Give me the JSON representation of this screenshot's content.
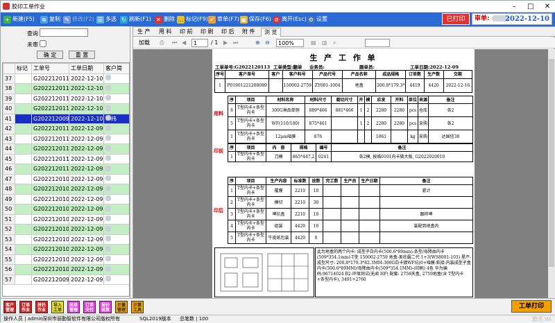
{
  "window": {
    "title": "胶印工单作业"
  },
  "toolbar": {
    "new": "新建(F5)",
    "copy": "复制",
    "modify": "修改(F2)",
    "multiselect": "多选",
    "refresh": "刷新(F1)",
    "delete": "删除",
    "mark": "标记(F9)",
    "review": "审单(F7)",
    "save": "保存(F6)",
    "exit": "离开(Esc)",
    "settings": "设置"
  },
  "status_badges": {
    "printed": "已打印",
    "review_label": "审单:",
    "review_date": "2022-12-10"
  },
  "filter": {
    "query_label": "查询",
    "unreviewed_label": "未审",
    "confirm": "确 定",
    "reset": "重 置"
  },
  "list": {
    "columns": [
      "",
      "标记",
      "工单号",
      "工单日期",
      "客户简"
    ],
    "rows": [
      {
        "n": "37",
        "id": "G2022120118",
        "date": "2022-12-10",
        "style": "w",
        "tail": ""
      },
      {
        "n": "38",
        "id": "G2022120117",
        "date": "2022-12-10",
        "style": "g",
        "tail": ""
      },
      {
        "n": "39",
        "id": "G2022120116",
        "date": "2022-12-10",
        "style": "w",
        "tail": ""
      },
      {
        "n": "40",
        "id": "G2022120115",
        "date": "2022-12-10",
        "style": "g",
        "tail": ""
      },
      {
        "n": "41",
        "id": "G2022120099",
        "date": "2022-12-10",
        "style": "sel",
        "tail": "纬"
      },
      {
        "n": "42",
        "id": "G2022120114",
        "date": "2022-12-09",
        "style": "g",
        "tail": ""
      },
      {
        "n": "43",
        "id": "G2022120113",
        "date": "2022-12-09",
        "style": "w",
        "tail": ""
      },
      {
        "n": "44",
        "id": "G2022120112",
        "date": "2022-12-09",
        "style": "g",
        "tail": ""
      },
      {
        "n": "45",
        "id": "G2022120111",
        "date": "2022-12-09",
        "style": "w",
        "tail": ""
      },
      {
        "n": "46",
        "id": "G2022120110",
        "date": "2022-12-09",
        "style": "g",
        "tail": ""
      },
      {
        "n": "47",
        "id": "G2022120109",
        "date": "2022-12-09",
        "style": "w",
        "tail": ""
      },
      {
        "n": "48",
        "id": "G2022120108",
        "date": "2022-12-09",
        "style": "g",
        "tail": ""
      },
      {
        "n": "49",
        "id": "G2022120107",
        "date": "2022-12-09",
        "style": "w",
        "tail": ""
      },
      {
        "n": "50",
        "id": "G2022120106",
        "date": "2022-12-09",
        "style": "g",
        "tail": ""
      },
      {
        "n": "51",
        "id": "G2022120105",
        "date": "2022-12-09",
        "style": "w",
        "tail": ""
      },
      {
        "n": "52",
        "id": "G2022120104",
        "date": "2022-12-09",
        "style": "g",
        "tail": ""
      },
      {
        "n": "53",
        "id": "G2022120103",
        "date": "2022-12-09",
        "style": "w",
        "tail": ""
      },
      {
        "n": "54",
        "id": "G2022120102",
        "date": "2022-12-09",
        "style": "g",
        "tail": ""
      },
      {
        "n": "55",
        "id": "G2022120101",
        "date": "2022-12-09",
        "style": "w",
        "tail": ""
      },
      {
        "n": "56",
        "id": "G2022120100",
        "date": "2022-12-09",
        "style": "g",
        "tail": ""
      },
      {
        "n": "57",
        "id": "G2022120098",
        "date": "2022-12-09",
        "style": "w",
        "tail": ""
      }
    ]
  },
  "tabs": [
    "生 产",
    "用 料",
    "印 前",
    "印 刷",
    "印 后",
    "附 件",
    "浏 览"
  ],
  "viewer_toolbar": {
    "load": "加载",
    "page": "1",
    "of": "/ 1",
    "zoom": "100%"
  },
  "doc": {
    "title": "生 产 工 作 单",
    "order_no": "工单单号:G2022120113",
    "type": "工单类型:翻单",
    "sales": "业务员:",
    "follow": "跟单员:",
    "date": "工单日期:2022-12-09",
    "main_head": [
      "序号",
      "客户单号",
      "客户",
      "客户料号",
      "产品代号",
      "产品名称",
      "成品规格",
      "订单数",
      "生产数",
      "交期"
    ],
    "main_row": [
      "1",
      "P01901221208089",
      "",
      "150002-2759",
      "ZY001-1004",
      "地盒",
      "200.8*179.3*82.3",
      "4419",
      "4420",
      "2022-12-16"
    ],
    "mat_label": "用料",
    "mat_head": [
      "序",
      "项目",
      "材料名称",
      "材料尺寸",
      "裁切尺寸",
      "开",
      "模",
      "应发",
      "开料",
      "单位",
      "来源",
      "备注"
    ],
    "mat_rows": [
      [
        "8",
        "T型内卡+条型内卡",
        "300G淋品单铜",
        "889*466",
        "881*466",
        "1",
        "2",
        "2280",
        "2280",
        "pcs",
        "仓库",
        "各2"
      ],
      [
        "5",
        "T型内卡+条型内卡",
        "WF(110/100)",
        "875*461",
        "",
        "1",
        "2",
        "2280",
        "2280",
        "pcs",
        "采购",
        "各2"
      ],
      [
        "1",
        "T型内卡+条型内卡",
        "12μm哑膜",
        "876",
        "",
        "",
        "",
        "1061",
        "",
        "kg",
        "采购",
        "达国信38"
      ]
    ],
    "pre_label": "印前",
    "pre_head": [
      "序",
      "项目",
      "内　容",
      "规格",
      "编号",
      "备注"
    ],
    "pre_row": [
      "1",
      "T型内卡+条型内卡",
      "刀模",
      "865*447.2",
      "0241",
      "各2模, 按临0101内卡做大版, G2022020010"
    ],
    "post_label": "印后",
    "post_head": [
      "序",
      "项目",
      "生产内容",
      "标准数",
      "放数",
      "完工数",
      "生产员",
      "生产日期",
      "备注"
    ],
    "post_rows": [
      [
        "1",
        "T型内卡+条型内卡",
        "覆膜",
        "2210",
        "10",
        "",
        "",
        "",
        "紧计"
      ],
      [
        "2",
        "T型内卡+条型内卡",
        "模切",
        "2210",
        "30",
        "",
        "",
        "",
        ""
      ],
      [
        "3",
        "T型内卡+条型内卡",
        "啤抗盒",
        "2210",
        "10",
        "",
        "",
        "",
        "跟样啤"
      ],
      [
        "4",
        "T型内卡+条型内卡",
        "组装",
        "4420",
        "10",
        "",
        "",
        "",
        "装配到地盒内"
      ],
      [
        "5",
        "T型内卡+条型内卡",
        "牛皮纸包装",
        "4420",
        "0",
        "",
        "",
        "",
        ""
      ]
    ],
    "note": "此为地盒的两个内卡: 成型子白内卡(500.6*89mm)-条型/母降由内卡(509*354.1mm)-T型 150002-2759 地盒-美柱霸二代 1+3(WS8001-103) 星产-成型尺寸: 200.8*179.3*82.3MM-300G白卡镀WF坑(0+哑膜-粘接-内装成型子盒内卡(500.6*89MM)/母降由内卡(509*354.1MM)-(印刷) 4色 华为编码:96714024 B2-环保测试(无卤 HF) 配套: 2758天盒, 2759地盒(含 T型内卡+条型内卡), 3491+2760"
  },
  "bottom_buttons": [
    "客户管理",
    "订单作业",
    "拼托作业",
    "导入工单",
    "出单管理",
    "订单交付",
    "报价核算",
    "计量管理",
    "计算工具"
  ],
  "print_button": "工单打印",
  "statusbar": {
    "user": "操作人员 | admin",
    "company": "深圳市丽勤智软件有限公司版权所有",
    "version": "SQL2019版本",
    "total": "总笔数 | 100",
    "watermark": "激活 Wi"
  },
  "colors": {
    "toolbar": "#2a6ad4",
    "selected_row": "#1a2fc4",
    "green_row": "#c4eec4",
    "print_button": "#f0a000"
  }
}
